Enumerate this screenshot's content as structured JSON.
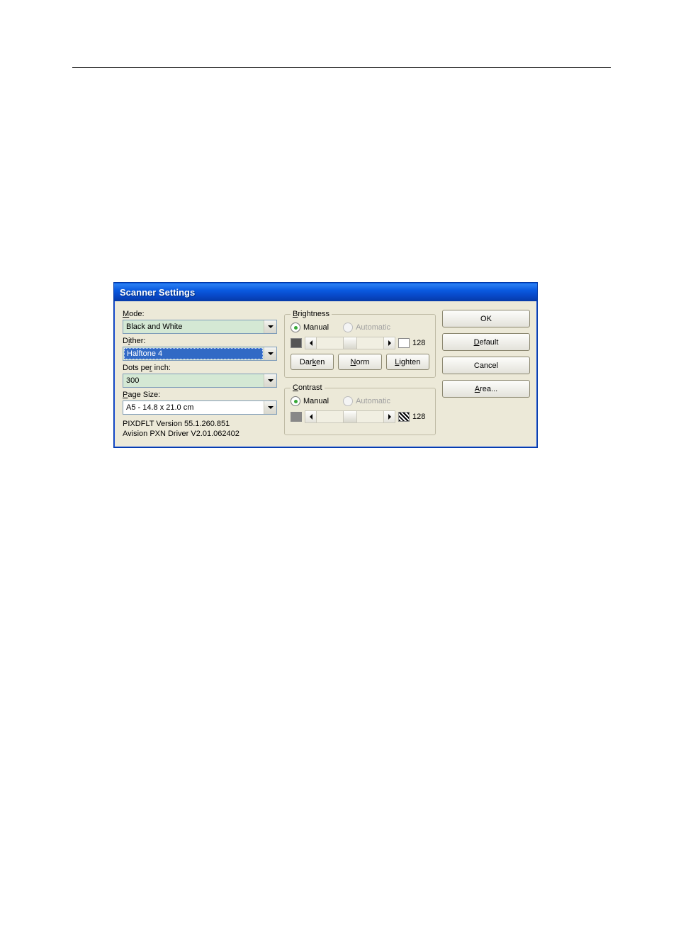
{
  "titlebar": {
    "title": "Scanner Settings"
  },
  "left": {
    "mode_label": "Mode:",
    "mode_value": "Black and White",
    "dither_label": "Dither:",
    "dither_value": "Halftone 4",
    "dpi_label": "Dots per inch:",
    "dpi_value": "300",
    "page_label": "Page Size:",
    "page_value": "A5 - 14.8 x 21.0 cm",
    "version1": "PIXDFLT Version 55.1.260.851",
    "version2": "Avision PXN Driver V2.01.062402"
  },
  "brightness": {
    "legend": "Brightness",
    "manual": "Manual",
    "automatic": "Automatic",
    "value": "128",
    "darken": "Darken",
    "norm": "Norm",
    "lighten": "Lighten"
  },
  "contrast": {
    "legend": "Contrast",
    "manual": "Manual",
    "automatic": "Automatic",
    "value": "128"
  },
  "buttons": {
    "ok": "OK",
    "default": "Default",
    "cancel": "Cancel",
    "area": "Area..."
  }
}
